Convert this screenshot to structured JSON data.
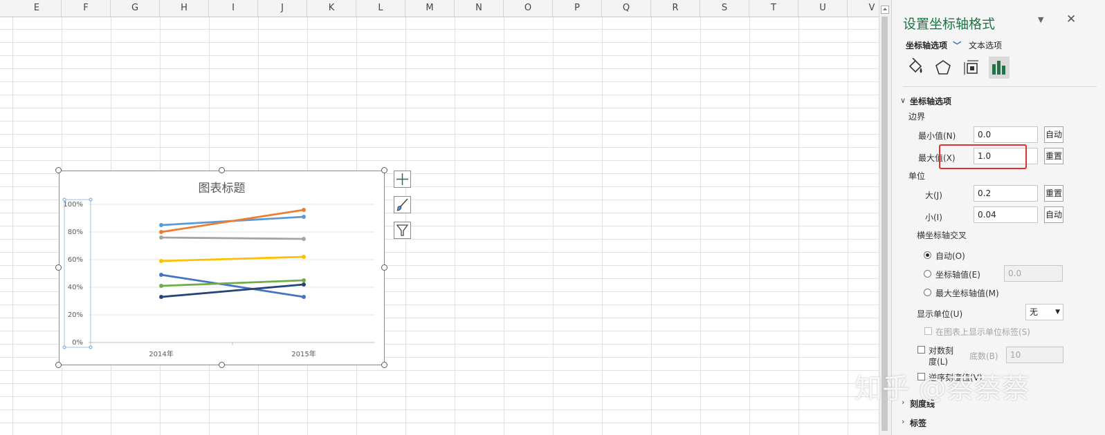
{
  "sheet": {
    "columns": [
      "E",
      "F",
      "G",
      "H",
      "I",
      "J",
      "K",
      "L",
      "M",
      "N",
      "O",
      "P",
      "Q",
      "R",
      "S",
      "T",
      "U",
      "V"
    ]
  },
  "chart": {
    "title": "图表标题",
    "side_buttons": [
      "chart-elements-icon",
      "chart-styles-icon",
      "chart-filters-icon"
    ]
  },
  "chart_data": {
    "type": "line",
    "title": "图表标题",
    "categories": [
      "2014年",
      "2015年"
    ],
    "ylim": [
      0,
      1
    ],
    "yticks": [
      "0%",
      "20%",
      "40%",
      "60%",
      "80%",
      "100%"
    ],
    "grid": true,
    "legend": "none",
    "series": [
      {
        "color": "#5b9bd5",
        "values": [
          0.85,
          0.91
        ]
      },
      {
        "color": "#ed7d31",
        "values": [
          0.8,
          0.96
        ]
      },
      {
        "color": "#a5a5a5",
        "values": [
          0.76,
          0.75
        ]
      },
      {
        "color": "#ffc000",
        "values": [
          0.59,
          0.62
        ]
      },
      {
        "color": "#4472c4",
        "values": [
          0.49,
          0.33
        ]
      },
      {
        "color": "#70ad47",
        "values": [
          0.41,
          0.45
        ]
      },
      {
        "color": "#264478",
        "values": [
          0.33,
          0.42
        ]
      }
    ]
  },
  "pane": {
    "title": "设置坐标轴格式",
    "dropdown_icon": "dropdown-arrow-icon",
    "close_icon": "close-icon",
    "tab_axis_options": "坐标轴选项",
    "tab_text_options": "文本选项",
    "icons": [
      "fill-line-icon",
      "effects-pentagon-icon",
      "size-properties-icon",
      "axis-options-bar-icon"
    ],
    "section_axis_options": "坐标轴选项",
    "bounds_label": "边界",
    "min_label": "最小值(N)",
    "min_value": "0.0",
    "min_btn": "自动",
    "max_label": "最大值(X)",
    "max_value": "1.0",
    "max_btn": "重置",
    "units_label": "单位",
    "major_label": "大(J)",
    "major_value": "0.2",
    "major_btn": "重置",
    "minor_label": "小(I)",
    "minor_value": "0.04",
    "minor_btn": "自动",
    "cross_label": "横坐标轴交叉",
    "radio_auto": "自动(O)",
    "radio_axis_value": "坐标轴值(E)",
    "axis_value": "0.0",
    "radio_max_axis": "最大坐标轴值(M)",
    "display_units_label": "显示单位(U)",
    "display_units_value": "无",
    "show_units_chk": "在图表上显示单位标签(S)",
    "log_chk_line1": "对数刻",
    "log_chk_line2": "度(L)",
    "base_label": "底数(B)",
    "base_value": "10",
    "reverse_chk": "逆序刻度值(V)",
    "section_ticks": "刻度线",
    "section_labels": "标签"
  },
  "watermark": "知乎 @蔡蔡蔡"
}
